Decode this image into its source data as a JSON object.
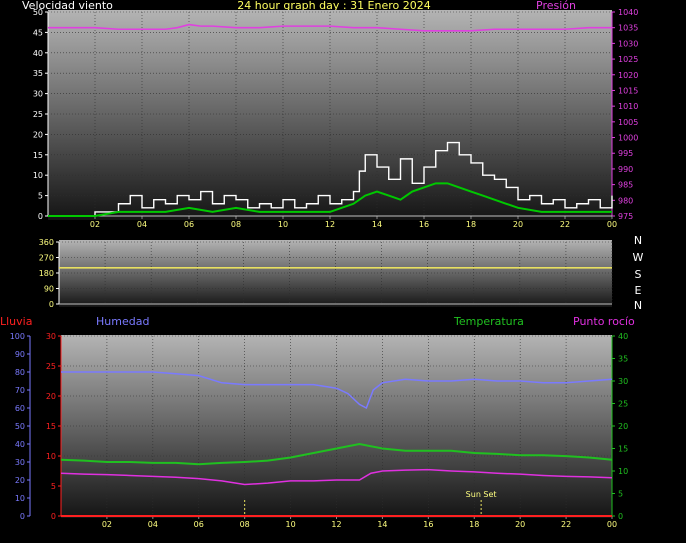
{
  "header": {
    "left": "Velocidad viento",
    "center": "24 hour graph day : 31 Enero 2024",
    "right": "Presión"
  },
  "wind_dir_letters": [
    "N",
    "W",
    "S",
    "E",
    "N"
  ],
  "bottom_labels": {
    "lluvia": "Lluvia",
    "humedad": "Humedad",
    "temperatura": "Temperatura",
    "punto_rocio": "Punto rocío",
    "sunset": "Sun Set"
  },
  "colors": {
    "wind_speed": "#ffffff",
    "wind_avg": "#00c800",
    "pressure": "#e040e0",
    "direction": "#e8e060",
    "humidity": "#7a7aff",
    "temperature": "#20c020",
    "dewpoint": "#e030e0",
    "rain": "#ff2020",
    "hour_labels": "#ffff80"
  },
  "chart_data": [
    {
      "type": "line",
      "title": "24 hour graph day : 31 Enero 2024",
      "ylabel": "Velocidad viento",
      "y2label": "Presión",
      "ylim": [
        0,
        50
      ],
      "y2lim": [
        975,
        1040
      ],
      "y_ticks": [
        "0",
        "5",
        "10",
        "15",
        "20",
        "25",
        "30",
        "35",
        "40",
        "45",
        "50"
      ],
      "y2_ticks": [
        "975",
        "980",
        "985",
        "990",
        "995",
        "1000",
        "1005",
        "1010",
        "1015",
        "1020",
        "1025",
        "1030",
        "1035",
        "1040"
      ],
      "x_ticks": [
        "02",
        "04",
        "06",
        "08",
        "10",
        "12",
        "14",
        "16",
        "18",
        "20",
        "22",
        "00"
      ],
      "series": [
        {
          "name": "Velocidad viento",
          "x": [
            0,
            1,
            2,
            3,
            3.5,
            4,
            4.5,
            5,
            5.5,
            6,
            6.5,
            7,
            7.5,
            8,
            8.5,
            9,
            9.5,
            10,
            10.5,
            11,
            11.5,
            12,
            12.5,
            13,
            13.25,
            13.5,
            14,
            14.5,
            15,
            15.5,
            16,
            16.5,
            17,
            17.5,
            18,
            18.5,
            19,
            19.5,
            20,
            20.5,
            21,
            21.5,
            22,
            22.5,
            23,
            23.5,
            24
          ],
          "y": [
            0,
            0,
            1,
            3,
            5,
            2,
            4,
            3,
            5,
            4,
            6,
            3,
            5,
            4,
            2,
            3,
            2,
            4,
            2,
            3,
            5,
            3,
            4,
            6,
            11,
            15,
            12,
            9,
            14,
            8,
            12,
            16,
            18,
            15,
            13,
            10,
            9,
            7,
            4,
            5,
            3,
            4,
            2,
            3,
            4,
            2,
            5
          ]
        },
        {
          "name": "Promedio viento",
          "x": [
            0,
            1,
            2,
            3,
            4,
            5,
            6,
            7,
            8,
            9,
            10,
            11,
            12,
            12.5,
            13,
            13.5,
            14,
            14.5,
            15,
            15.5,
            16,
            16.5,
            17,
            17.5,
            18,
            18.5,
            19,
            19.5,
            20,
            21,
            22,
            23,
            24
          ],
          "y": [
            0,
            0,
            0,
            1,
            1,
            1,
            2,
            1,
            2,
            1,
            1,
            1,
            1,
            2,
            3,
            5,
            6,
            5,
            4,
            6,
            7,
            8,
            8,
            7,
            6,
            5,
            4,
            3,
            2,
            1,
            1,
            1,
            1
          ]
        },
        {
          "name": "Presión",
          "x": [
            0,
            1,
            2,
            3,
            4,
            5,
            5.5,
            6,
            6.5,
            7,
            8,
            9,
            10,
            11,
            12,
            13,
            14,
            15,
            16,
            17,
            18,
            19,
            20,
            21,
            22,
            23,
            24
          ],
          "y": [
            1035,
            1035,
            1035,
            1034.5,
            1034.5,
            1034.5,
            1035,
            1036,
            1035.5,
            1035.5,
            1035,
            1035,
            1035.5,
            1035.5,
            1035.5,
            1035,
            1035,
            1034.5,
            1034,
            1034,
            1034,
            1034.5,
            1034.5,
            1034.5,
            1034.5,
            1035,
            1035
          ]
        }
      ]
    },
    {
      "type": "line",
      "ylim": [
        0,
        360
      ],
      "y_ticks": [
        "0",
        "90",
        "180",
        "270",
        "360"
      ],
      "series": [
        {
          "name": "Dirección viento",
          "x": [
            0,
            24
          ],
          "y": [
            210,
            210
          ]
        }
      ]
    },
    {
      "type": "line",
      "ylim": [
        0,
        30
      ],
      "y_ticks": [
        "0",
        "5",
        "10",
        "15",
        "20",
        "25",
        "30"
      ],
      "y_hum_ticks": [
        "0",
        "10",
        "20",
        "30",
        "40",
        "50",
        "60",
        "70",
        "80",
        "90",
        "100"
      ],
      "y_temp_ticks": [
        "0",
        "5",
        "10",
        "15",
        "20",
        "25",
        "30",
        "35",
        "40"
      ],
      "x_ticks": [
        "02",
        "04",
        "06",
        "08",
        "10",
        "12",
        "14",
        "16",
        "18",
        "20",
        "22",
        "00"
      ],
      "markers": [
        {
          "x": 8.0,
          "label": ""
        },
        {
          "x": 18.3,
          "label": "Sun Set"
        }
      ],
      "series": [
        {
          "name": "Lluvia",
          "x": [
            0,
            24
          ],
          "y": [
            0,
            0
          ]
        },
        {
          "name": "Humedad",
          "x": [
            0,
            1,
            2,
            3,
            4,
            5,
            6,
            7,
            8,
            9,
            10,
            11,
            12,
            12.5,
            13,
            13.3,
            13.6,
            14,
            15,
            16,
            17,
            18,
            19,
            20,
            21,
            22,
            23,
            24
          ],
          "y": [
            80,
            80,
            80,
            80,
            80,
            79,
            78,
            74,
            73,
            73,
            73,
            73,
            71,
            68,
            62,
            60,
            70,
            74,
            76,
            75,
            75,
            76,
            75,
            75,
            74,
            74,
            75,
            76
          ]
        },
        {
          "name": "Temperatura",
          "x": [
            0,
            1,
            2,
            3,
            4,
            5,
            6,
            7,
            8,
            9,
            10,
            11,
            12,
            12.5,
            13,
            13.5,
            14,
            15,
            16,
            17,
            18,
            19,
            20,
            21,
            22,
            23,
            24
          ],
          "y": [
            12.5,
            12.3,
            12,
            12,
            11.8,
            11.8,
            11.5,
            11.8,
            12,
            12.3,
            13,
            14,
            15,
            15.5,
            16,
            15.5,
            15,
            14.5,
            14.5,
            14.5,
            14,
            13.8,
            13.5,
            13.5,
            13.3,
            13,
            12.5
          ]
        },
        {
          "name": "Punto rocío",
          "x": [
            0,
            1,
            2,
            3,
            4,
            5,
            6,
            7,
            8,
            9,
            10,
            11,
            12,
            13,
            13.5,
            14,
            15,
            16,
            17,
            18,
            19,
            20,
            21,
            22,
            23,
            24
          ],
          "y": [
            9.5,
            9.3,
            9.2,
            9.0,
            8.8,
            8.6,
            8.3,
            7.8,
            7.0,
            7.3,
            7.8,
            7.8,
            8.0,
            8.0,
            9.5,
            10,
            10.2,
            10.3,
            10,
            9.8,
            9.5,
            9.3,
            9.0,
            8.8,
            8.7,
            8.5
          ]
        }
      ]
    }
  ]
}
